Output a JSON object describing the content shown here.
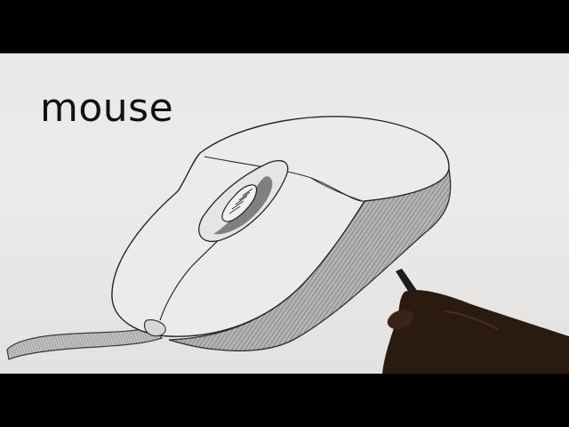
{
  "video_frame": {
    "caption": "mouse"
  },
  "illustration": {
    "subject": "computer-mouse-pencil-sketch",
    "hand_present": true,
    "tool": "pencil",
    "colors": {
      "paper": "#e9e8e6",
      "graphite": "#2a2a2a",
      "shading": "#8a8a88",
      "skin": "#2b1a10",
      "letterbox": "#000000"
    }
  }
}
